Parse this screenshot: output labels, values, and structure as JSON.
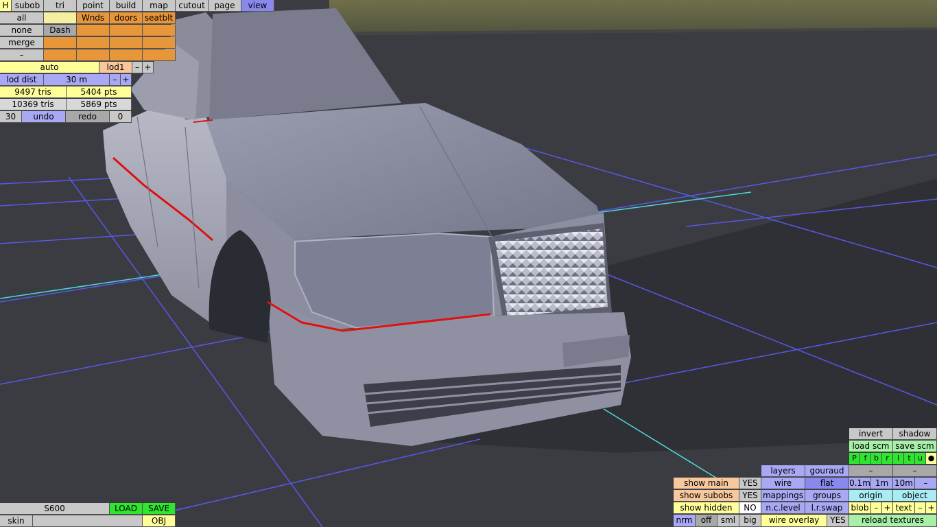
{
  "colors": {
    "orange": "#e8963a",
    "yellow": "#ffff99",
    "blue": "#a8a8f4",
    "green": "#a8f0a8",
    "bright_green": "#2ee62e",
    "grey": "#c8c8c8",
    "peach": "#f8c89c",
    "cyan": "#a8ecf4"
  },
  "top_menu": {
    "h": "H",
    "subob": "subob",
    "tri": "tri",
    "point": "point",
    "build": "build",
    "map": "map",
    "cutout": "cutout",
    "page": "page",
    "view": "view"
  },
  "subob_panel": {
    "all": "all",
    "none": "none",
    "merge": "merge",
    "minus": "–",
    "dash": "Dash",
    "wnds": "Wnds",
    "doors": "doors",
    "seatblt": "seatblt"
  },
  "lod": {
    "auto": "auto",
    "lod1": "lod1",
    "minus": "–",
    "plus": "+",
    "lod_dist_label": "lod dist",
    "lod_dist_value": "30 m"
  },
  "stats": {
    "tris1": "9497 tris",
    "pts1": "5404 pts",
    "tris2": "10369 tris",
    "pts2": "5869 pts"
  },
  "history": {
    "count": "30",
    "undo": "undo",
    "redo": "redo",
    "zero": "0"
  },
  "file_panel": {
    "model_name": "S600",
    "load": "LOAD",
    "save": "SAVE",
    "skin": "skin",
    "skin_value": "",
    "obj": "OBJ"
  },
  "view_panel": {
    "invert": "invert",
    "shadow": "shadow",
    "load_scm": "load scm",
    "save_scm": "save scm",
    "glyphs": [
      "P",
      "f",
      "b",
      "r",
      "l",
      "t",
      "u",
      "●"
    ],
    "minus": "–",
    "layers": "layers",
    "gouraud": "gouraud",
    "show_main": "show main",
    "show_main_val": "YES",
    "wire": "wire",
    "flat": "flat",
    "dist_01": "0.1m",
    "dist_1": "1m",
    "dist_10": "10m",
    "show_subobs": "show subobs",
    "show_subobs_val": "YES",
    "mappings": "mappings",
    "groups": "groups",
    "origin": "origin",
    "object": "object",
    "show_hidden": "show hidden",
    "show_hidden_val": "NO",
    "nc_level": "n.c.level",
    "lr_swap": "l.r.swap",
    "blob": "blob",
    "text": "text",
    "plus": "+",
    "nrm": "nrm",
    "off": "off",
    "sml": "sml",
    "big": "big",
    "wire_overlay": "wire overlay",
    "wire_overlay_val": "YES",
    "reload_textures": "reload textures"
  }
}
